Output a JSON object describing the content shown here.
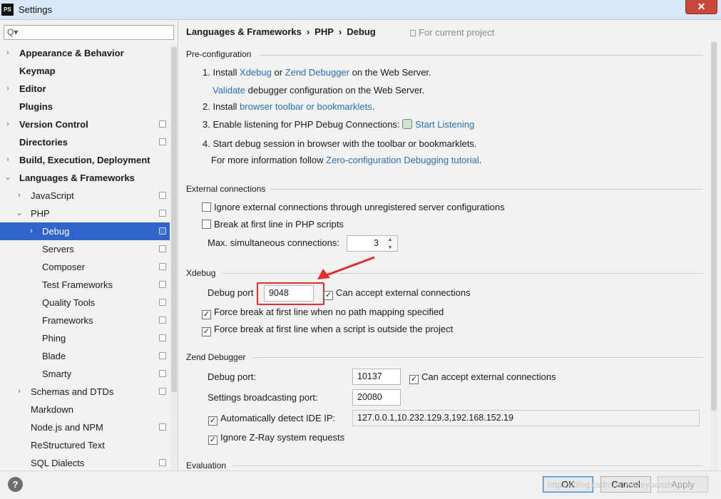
{
  "window": {
    "app_icon": "PS",
    "title": "Settings",
    "close_glyph": "✕"
  },
  "search": {
    "glyph": "Q▾",
    "placeholder": ""
  },
  "sidebar": {
    "items": [
      {
        "label": "Appearance & Behavior",
        "bold": true,
        "arrow": "›",
        "project": false
      },
      {
        "label": "Keymap",
        "bold": true,
        "arrow": "",
        "project": false
      },
      {
        "label": "Editor",
        "bold": true,
        "arrow": "›",
        "project": false
      },
      {
        "label": "Plugins",
        "bold": true,
        "arrow": "",
        "project": false
      },
      {
        "label": "Version Control",
        "bold": true,
        "arrow": "›",
        "project": true
      },
      {
        "label": "Directories",
        "bold": true,
        "arrow": "",
        "project": true
      },
      {
        "label": "Build, Execution, Deployment",
        "bold": true,
        "arrow": "›",
        "project": false
      },
      {
        "label": "Languages & Frameworks",
        "bold": true,
        "arrow": "⌄",
        "project": false
      },
      {
        "label": "JavaScript",
        "bold": false,
        "arrow": "›",
        "project": true
      },
      {
        "label": "PHP",
        "bold": false,
        "arrow": "⌄",
        "project": true
      },
      {
        "label": "Debug",
        "bold": false,
        "arrow": "›",
        "project": true,
        "selected": true
      },
      {
        "label": "Servers",
        "bold": false,
        "arrow": "",
        "project": true
      },
      {
        "label": "Composer",
        "bold": false,
        "arrow": "",
        "project": true
      },
      {
        "label": "Test Frameworks",
        "bold": false,
        "arrow": "",
        "project": true
      },
      {
        "label": "Quality Tools",
        "bold": false,
        "arrow": "",
        "project": true
      },
      {
        "label": "Frameworks",
        "bold": false,
        "arrow": "",
        "project": true
      },
      {
        "label": "Phing",
        "bold": false,
        "arrow": "",
        "project": true
      },
      {
        "label": "Blade",
        "bold": false,
        "arrow": "",
        "project": true
      },
      {
        "label": "Smarty",
        "bold": false,
        "arrow": "",
        "project": true
      },
      {
        "label": "Schemas and DTDs",
        "bold": false,
        "arrow": "›",
        "project": true
      },
      {
        "label": "Markdown",
        "bold": false,
        "arrow": "",
        "project": false
      },
      {
        "label": "Node.js and NPM",
        "bold": false,
        "arrow": "",
        "project": true
      },
      {
        "label": "ReStructured Text",
        "bold": false,
        "arrow": "",
        "project": false
      },
      {
        "label": "SQL Dialects",
        "bold": false,
        "arrow": "",
        "project": true
      }
    ]
  },
  "breadcrumb": {
    "items": [
      "Languages & Frameworks",
      "PHP",
      "Debug"
    ],
    "separator": "›",
    "scope_note": "For current project"
  },
  "preconfig": {
    "title": "Pre-configuration",
    "step1_prefix": "1. Install ",
    "link_xdebug": "Xdebug",
    "or": " or ",
    "link_zend": "Zend Debugger",
    "step1_suffix": " on the Web Server.",
    "link_validate": "Validate",
    "validate_suffix": " debugger configuration on the Web Server.",
    "step2_prefix": "2. Install ",
    "link_toolbar": "browser toolbar or bookmarklets",
    "step2_suffix": ".",
    "step3_prefix": "3. Enable listening for PHP Debug Connections: ",
    "link_listen": "Start Listening",
    "step4": "4. Start debug session in browser with the toolbar or bookmarklets.",
    "more_prefix": "For more information follow ",
    "link_tutorial": "Zero-configuration Debugging tutorial",
    "more_suffix": "."
  },
  "external": {
    "title": "External connections",
    "ignore_label": "Ignore external connections through unregistered server configurations",
    "ignore_checked": false,
    "break_label": "Break at first line in PHP scripts",
    "break_checked": false,
    "max_label": "Max. simultaneous connections:",
    "max_value": "3",
    "spin_up": "▲",
    "spin_down": "▼"
  },
  "xdebug": {
    "title": "Xdebug",
    "port_label": "Debug port",
    "port_value": "9048",
    "accept_label": "Can accept external connections",
    "accept_checked": true,
    "force_nomap_label": "Force break at first line when no path mapping specified",
    "force_nomap_checked": true,
    "force_outside_label": "Force break at first line when a script is outside the project",
    "force_outside_checked": true
  },
  "zend": {
    "title": "Zend Debugger",
    "port_label": "Debug port:",
    "port_value": "10137",
    "accept_label": "Can accept external connections",
    "accept_checked": true,
    "broadcast_label": "Settings broadcasting port:",
    "broadcast_value": "20080",
    "detect_label": "Automatically detect IDE IP:",
    "detect_checked": true,
    "detect_value": "127.0.0.1,10.232.129.3,192.168.152.19",
    "zray_label": "Ignore Z-Ray system requests",
    "zray_checked": true
  },
  "evaluation": {
    "title": "Evaluation"
  },
  "checkmark": "✓",
  "buttons": {
    "help": "?",
    "ok": "OK",
    "cancel": "Cancel",
    "apply": "Apply"
  },
  "watermark": "https://blog.csdn.net/wareyuanzh",
  "colors": {
    "accent": "#2f65ca",
    "link": "#2a6fb5",
    "annotation": "#e22d2d"
  }
}
